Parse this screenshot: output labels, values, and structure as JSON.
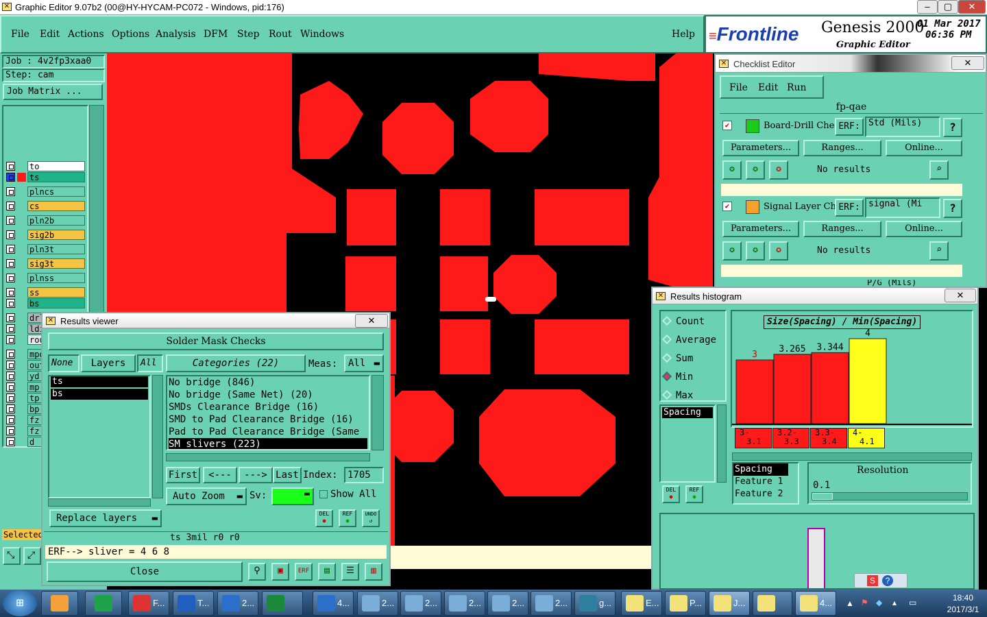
{
  "window": {
    "title": "Graphic Editor 9.07b2 (00@HY-HYCAM-PC072 - Windows, pid:176)"
  },
  "menubar": {
    "items": [
      "File",
      "Edit",
      "Actions",
      "Options",
      "Analysis",
      "DFM",
      "Step",
      "Rout",
      "Windows"
    ],
    "help": "Help"
  },
  "brand": {
    "logo": "Frontline",
    "product": "Genesis 2000",
    "date": "01 Mar 2017",
    "time": "06:36 PM",
    "subtitle": "Graphic Editor"
  },
  "job": {
    "job_label": "Job : 4v2fp3xaa0",
    "step_label": "Step: cam",
    "matrix_button": "Job Matrix ..."
  },
  "layers": [
    {
      "name": "to",
      "color": "#ffffff"
    },
    {
      "name": "ts",
      "color": "#20b38a"
    },
    {
      "name": "plncs",
      "color": "#6ad1b3"
    },
    {
      "name": "cs",
      "color": "#f6c445"
    },
    {
      "name": "pln2b",
      "color": "#6ad1b3"
    },
    {
      "name": "sig2b",
      "color": "#f6c445"
    },
    {
      "name": "pln3t",
      "color": "#6ad1b3"
    },
    {
      "name": "sig3t",
      "color": "#f6c445"
    },
    {
      "name": "plnss",
      "color": "#6ad1b3"
    },
    {
      "name": "ss",
      "color": "#f6c445"
    },
    {
      "name": "bs",
      "color": "#20b38a"
    },
    {
      "name": "drl",
      "color": "#b4b4b4"
    },
    {
      "name": "ldi",
      "color": "#b4b4b4"
    },
    {
      "name": "rout",
      "color": "#e8e8e8"
    },
    {
      "name": "mpdrl",
      "color": "#6ad1b3"
    },
    {
      "name": "outli",
      "color": "#6ad1b3"
    },
    {
      "name": "yd",
      "color": "#6ad1b3"
    },
    {
      "name": "mp",
      "color": "#6ad1b3"
    },
    {
      "name": "tp",
      "color": "#6ad1b3"
    },
    {
      "name": "bp",
      "color": "#6ad1b3"
    },
    {
      "name": "fz",
      "color": "#6ad1b3"
    },
    {
      "name": "fz",
      "color": "#6ad1b3"
    },
    {
      "name": "d",
      "color": "#6ad1b3"
    }
  ],
  "selected_label": "Selected",
  "results_viewer": {
    "title": "Results viewer",
    "header": "Solder Mask Checks",
    "none_btn": "None",
    "layers_btn": "Layers",
    "all_btn": "All",
    "categories_btn": "Categories (22)",
    "meas_label": "Meas:",
    "meas_value": "All",
    "layer_list": [
      "ts",
      "bs"
    ],
    "categories": [
      "No bridge (846)",
      "No bridge (Same Net) (20)",
      "SMDs Clearance Bridge (16)",
      "SMD to Pad Clearance Bridge (16)",
      "Pad to Pad Clearance Bridge (Same",
      "SM slivers (223)"
    ],
    "first": "First",
    "prev": "<---",
    "next": "--->",
    "last": "Last",
    "index_label": "Index:",
    "index_value": "1705",
    "auto_zoom": "Auto Zoom",
    "sv_label": "Sv:",
    "show_all": "Show All",
    "replace_layers": "Replace layers",
    "del": "DEL",
    "ref": "REF",
    "undo": "UNDO",
    "status": "ts 3mil  r0  r0",
    "erf_line": "ERF--> sliver = 4 6 8",
    "close": "Close"
  },
  "checklist": {
    "title": "Checklist Editor",
    "menu": [
      "File",
      "Edit",
      "Run"
    ],
    "name": "fp-qae",
    "erf_label": "ERF:",
    "help": "?",
    "params": "Parameters...",
    "ranges": "Ranges...",
    "online": "Online...",
    "no_results": "No results",
    "items": [
      {
        "label": "Board-Drill Che",
        "erf": "Std (Mils)"
      },
      {
        "label": "Signal Layer Ch",
        "erf": "signal (Mi"
      }
    ],
    "third_erf": "P/G (Mils)"
  },
  "histogram": {
    "title": "Results histogram",
    "modes": [
      "Count",
      "Average",
      "Sum",
      "Min",
      "Max"
    ],
    "selected_mode": "Min",
    "list_item": "Spacing",
    "chart_title": "Size(Spacing) / Min(Spacing)",
    "resolution_label": "Resolution",
    "resolution_value": "0.1",
    "field_list": [
      "Spacing",
      "Feature 1",
      "Feature 2"
    ],
    "del": "DEL",
    "ref": "REF"
  },
  "chart_data": {
    "type": "bar",
    "title": "Size(Spacing) / Min(Spacing)",
    "categories": [
      "3-3.1",
      "3.2-3.3",
      "3.3-3.4",
      "4-4.1"
    ],
    "category_labels": [
      [
        "3-",
        "3.1"
      ],
      [
        "3.2-",
        "3.3"
      ],
      [
        "3.3-",
        "3.4"
      ],
      [
        "4-",
        "4.1"
      ]
    ],
    "values": [
      3,
      3.265,
      3.344,
      4
    ],
    "value_labels": [
      "3",
      "3.265",
      "3.344",
      "4"
    ],
    "colors": [
      "#ff1a1a",
      "#ff1a1a",
      "#ff1a1a",
      "#ffff1a"
    ],
    "ylim": [
      0,
      4
    ]
  },
  "taskbar": {
    "buttons": [
      "F...",
      "T...",
      "2...",
      "4...",
      "2...",
      "2...",
      "2...",
      "2...",
      "2...",
      "g...",
      "E...",
      "P...",
      "J...",
      "4..."
    ],
    "clock_time": "18:40",
    "clock_date": "2017/3/1"
  }
}
